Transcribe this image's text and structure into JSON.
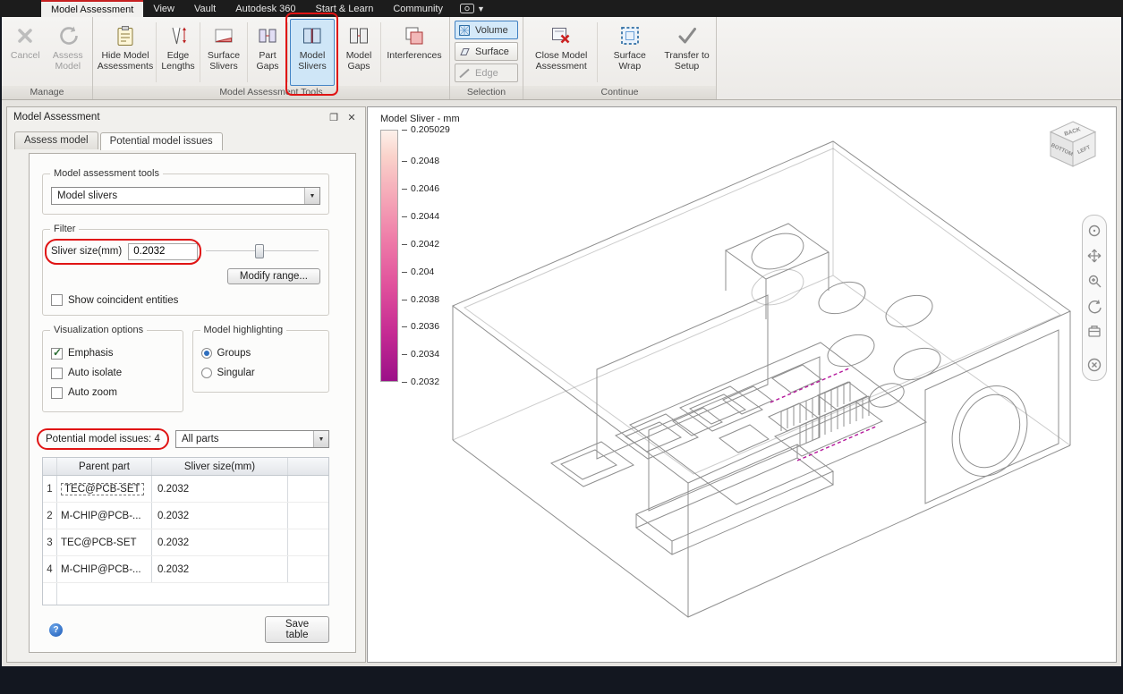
{
  "icons": {
    "caret_down": "▼",
    "close": "✕",
    "float": "❐",
    "help": "?"
  },
  "menubar": {
    "tabs": [
      {
        "label": "Model Assessment"
      },
      {
        "label": "View"
      },
      {
        "label": "Vault"
      },
      {
        "label": "Autodesk 360"
      },
      {
        "label": "Start & Learn"
      },
      {
        "label": "Community"
      }
    ]
  },
  "ribbon": {
    "manage": {
      "label": "Manage",
      "buttons": [
        {
          "label": "Cancel"
        },
        {
          "label": "Assess Model"
        }
      ]
    },
    "tools": {
      "label": "Model Assessment Tools",
      "buttons": [
        {
          "label": "Hide Model Assessments"
        },
        {
          "label": "Edge Lengths"
        },
        {
          "label": "Surface Slivers"
        },
        {
          "label": "Part Gaps"
        },
        {
          "label": "Model Slivers",
          "selected": true
        },
        {
          "label": "Model Gaps"
        },
        {
          "label": "Interferences"
        }
      ]
    },
    "selection": {
      "label": "Selection",
      "buttons": [
        {
          "label": "Volume",
          "selected": true
        },
        {
          "label": "Surface"
        },
        {
          "label": "Edge",
          "disabled": true
        }
      ]
    },
    "continue": {
      "label": "Continue",
      "buttons": [
        {
          "label": "Close Model Assessment"
        },
        {
          "label": "Surface Wrap"
        },
        {
          "label": "Transfer to Setup"
        }
      ]
    }
  },
  "panel": {
    "title": "Model Assessment",
    "tabs": [
      {
        "label": "Assess model"
      },
      {
        "label": "Potential model issues",
        "active": true
      }
    ],
    "tools": {
      "label": "Model assessment tools",
      "dropdown_value": "Model slivers"
    },
    "filter": {
      "label": "Filter",
      "sliver_size_label": "Sliver size(mm)",
      "sliver_size_value": "0.2032",
      "modify_range": "Modify range...",
      "show_coincident": "Show coincident entities",
      "show_coincident_checked": false
    },
    "visualization": {
      "label": "Visualization options",
      "options": [
        {
          "label": "Emphasis",
          "checked": true
        },
        {
          "label": "Auto isolate",
          "checked": false
        },
        {
          "label": "Auto zoom",
          "checked": false
        }
      ]
    },
    "highlighting": {
      "label": "Model highlighting",
      "options": [
        {
          "label": "Groups",
          "selected": true
        },
        {
          "label": "Singular",
          "selected": false
        }
      ]
    },
    "issues_label": "Potential model issues: 4",
    "parts_filter_value": "All parts",
    "table": {
      "headers": [
        "Parent part",
        "Sliver size(mm)"
      ],
      "rows": [
        {
          "n": "1",
          "parent": "TEC@PCB-SET",
          "size": "0.2032"
        },
        {
          "n": "2",
          "parent": "M-CHIP@PCB-...",
          "size": "0.2032"
        },
        {
          "n": "3",
          "parent": "TEC@PCB-SET",
          "size": "0.2032"
        },
        {
          "n": "4",
          "parent": "M-CHIP@PCB-...",
          "size": "0.2032"
        }
      ]
    },
    "save_table": "Save table"
  },
  "viewport": {
    "legend": {
      "title": "Model Sliver - mm",
      "ticks": [
        "0.205029",
        "0.2048",
        "0.2046",
        "0.2044",
        "0.2042",
        "0.204",
        "0.2038",
        "0.2036",
        "0.2034",
        "0.2032"
      ],
      "color_top": "#fdf1eb",
      "color_bottom": "#9b1088",
      "sliver_highlight_color": "#b5189b"
    },
    "viewcube_faces": {
      "top": "BACK",
      "left": "BOTTOM",
      "right": "LEFT"
    }
  }
}
